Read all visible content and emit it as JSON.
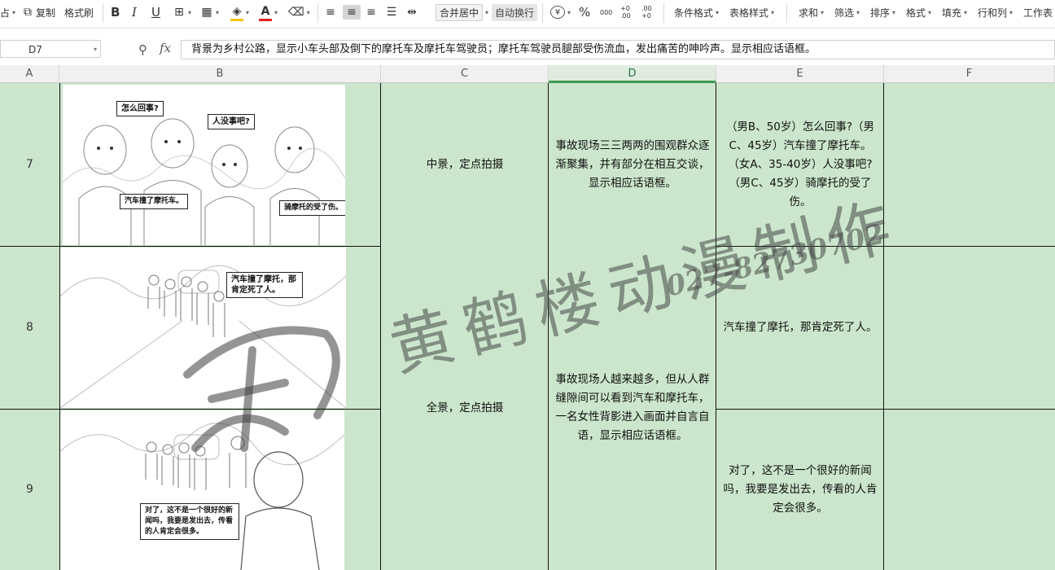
{
  "toolbar": {
    "paste_partial": "占",
    "copy": "复制",
    "format_painter": "格式刷",
    "bold": "B",
    "italic": "I",
    "underline": "U",
    "merge_center": "合并居中",
    "wrap_text": "自动换行",
    "currency": "¥",
    "percent": "%",
    "thousands": "000",
    "dec_inc": "+0 .00",
    "dec_dec": ".00 +0",
    "conditional_format": "条件格式",
    "table_style": "表格样式",
    "sum": "求和",
    "filter": "筛选",
    "sort": "排序",
    "format": "格式",
    "fill": "填充",
    "row_col": "行和列",
    "worksheet": "工作表"
  },
  "formula_bar": {
    "cell_ref": "D7",
    "fx_label": "fx",
    "content": "背景为乡村公路，显示小车头部及倒下的摩托车及摩托车驾驶员；摩托车驾驶员腿部受伤流血，发出痛苦的呻吟声。显示相应话语框。"
  },
  "columns": [
    "A",
    "B",
    "C",
    "D",
    "E",
    "F"
  ],
  "rows": [
    {
      "num": "7",
      "shot": "中景，定点拍摄",
      "desc": "事故现场三三两两的围观群众逐渐聚集，并有部分在相互交谈，显示相应话语框。",
      "dialog": "（男B、50岁）怎么回事?（男C、45岁）汽车撞了摩托车。（女A、35-40岁）人没事吧?（男C、45岁）骑摩托的受了伤。"
    },
    {
      "num": "8",
      "dialog": "汽车撞了摩托，那肯定死了人。"
    },
    {
      "num": "9",
      "dialog": "对了，这不是一个很好的新闻吗，我要是发出去，传看的人肯定会很多。"
    }
  ],
  "merged_8_9": {
    "shot": "全景，定点拍摄",
    "desc": "事故现场人越来越多，但从人群缝隙间可以看到汽车和摩托车，一名女性背影进入画面并自言自语，显示相应话语框。"
  },
  "storyboard": {
    "frame7": {
      "b1": "怎么回事?",
      "b2": "人没事吧?",
      "b3": "汽车撞了摩托车。",
      "b4": "骑摩托的受了伤。"
    },
    "frame8": {
      "b1": "汽车撞了摩托，那肯定死了人。"
    },
    "frame9": {
      "b1": "对了，这不是一个很好的新闻吗，我要是发出去，传看的人肯定会很多。"
    }
  },
  "watermark": {
    "chars": "黄鹤楼动漫制作",
    "phone": "027-82730702"
  },
  "colors": {
    "cell_fill": "#cbe6cc",
    "selected_col": "#3a9b4f",
    "grid_line": "#111111"
  }
}
